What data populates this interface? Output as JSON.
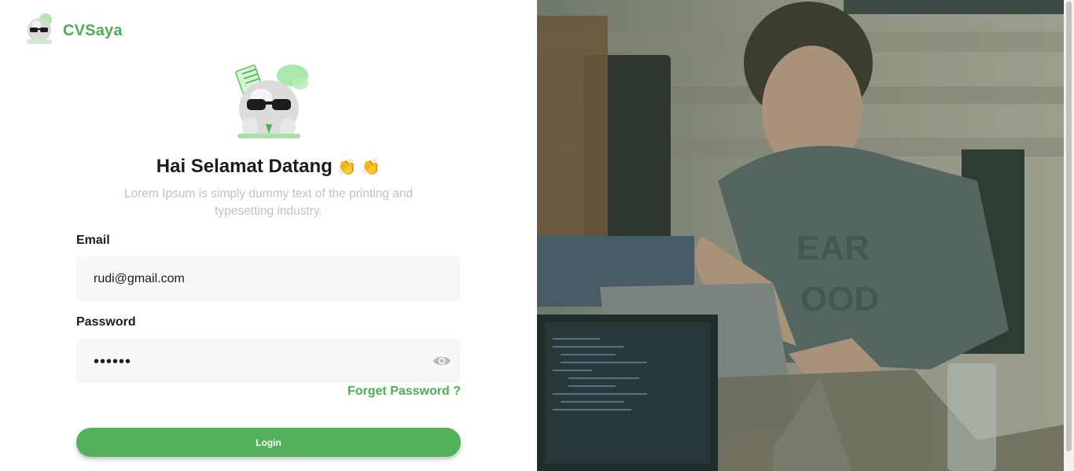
{
  "brand": {
    "name": "CVSaya",
    "logo_icon": "sunglasses-mascot-icon"
  },
  "hero": {
    "icon": "sunglasses-mascot-icon"
  },
  "welcome": {
    "title": "Hai Selamat Datang",
    "emoji": "👏 👏",
    "subtitle": "Lorem Ipsum is simply dummy text of the printing and typesetting industry."
  },
  "form": {
    "email_label": "Email",
    "email_value": "rudi@gmail.com",
    "password_label": "Password",
    "password_value": "••••••",
    "password_toggle_icon": "eye-icon",
    "forgot_label": "Forget Password ?",
    "login_label": "Login"
  },
  "colors": {
    "accent": "#4caf50",
    "button": "#52b15a",
    "field_bg": "#f7f7f7",
    "muted_text": "#c2c2c2"
  }
}
